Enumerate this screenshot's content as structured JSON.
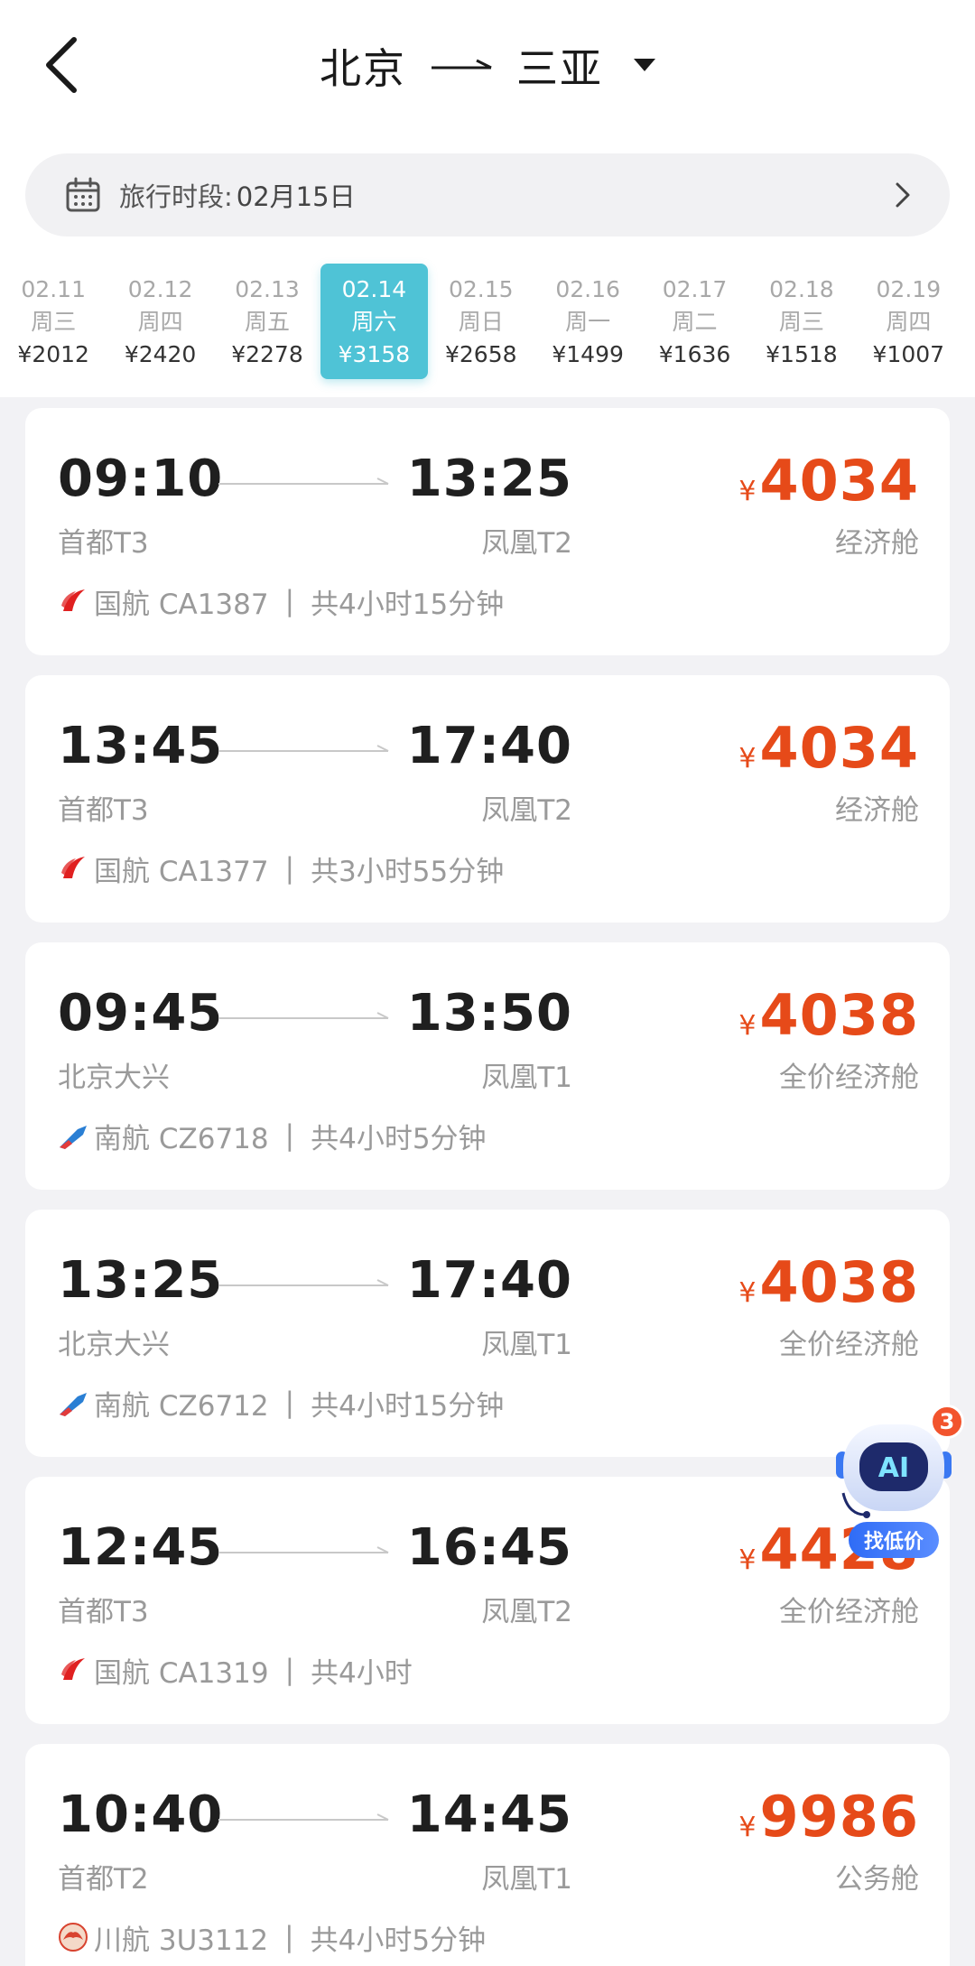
{
  "header": {
    "from": "北京",
    "to": "三亚"
  },
  "period": {
    "label": "旅行时段:",
    "value": "02月15日"
  },
  "dates": [
    {
      "date": "02.11",
      "weekday": "周三",
      "price": "¥2012",
      "active": false
    },
    {
      "date": "02.12",
      "weekday": "周四",
      "price": "¥2420",
      "active": false
    },
    {
      "date": "02.13",
      "weekday": "周五",
      "price": "¥2278",
      "active": false
    },
    {
      "date": "02.14",
      "weekday": "周六",
      "price": "¥3158",
      "active": true
    },
    {
      "date": "02.15",
      "weekday": "周日",
      "price": "¥2658",
      "active": false
    },
    {
      "date": "02.16",
      "weekday": "周一",
      "price": "¥1499",
      "active": false
    },
    {
      "date": "02.17",
      "weekday": "周二",
      "price": "¥1636",
      "active": false
    },
    {
      "date": "02.18",
      "weekday": "周三",
      "price": "¥1518",
      "active": false
    },
    {
      "date": "02.19",
      "weekday": "周四",
      "price": "¥1007",
      "active": false
    }
  ],
  "flights": [
    {
      "dep_time": "09:10",
      "arr_time": "13:25",
      "dep_airport": "首都T3",
      "arr_airport": "凤凰T2",
      "currency": "¥",
      "price": "4034",
      "cabin": "经济舱",
      "airline": "国航 CA1387",
      "separator": "|",
      "duration": "共4小时15分钟",
      "airline_icon": "air-china"
    },
    {
      "dep_time": "13:45",
      "arr_time": "17:40",
      "dep_airport": "首都T3",
      "arr_airport": "凤凰T2",
      "currency": "¥",
      "price": "4034",
      "cabin": "经济舱",
      "airline": "国航 CA1377",
      "separator": "|",
      "duration": "共3小时55分钟",
      "airline_icon": "air-china"
    },
    {
      "dep_time": "09:45",
      "arr_time": "13:50",
      "dep_airport": "北京大兴",
      "arr_airport": "凤凰T1",
      "currency": "¥",
      "price": "4038",
      "cabin": "全价经济舱",
      "airline": "南航 CZ6718",
      "separator": "|",
      "duration": "共4小时5分钟",
      "airline_icon": "china-southern"
    },
    {
      "dep_time": "13:25",
      "arr_time": "17:40",
      "dep_airport": "北京大兴",
      "arr_airport": "凤凰T1",
      "currency": "¥",
      "price": "4038",
      "cabin": "全价经济舱",
      "airline": "南航 CZ6712",
      "separator": "|",
      "duration": "共4小时15分钟",
      "airline_icon": "china-southern"
    },
    {
      "dep_time": "12:45",
      "arr_time": "16:45",
      "dep_airport": "首都T3",
      "arr_airport": "凤凰T2",
      "currency": "¥",
      "price": "4428",
      "cabin": "全价经济舱",
      "airline": "国航 CA1319",
      "separator": "|",
      "duration": "共4小时",
      "airline_icon": "air-china"
    },
    {
      "dep_time": "10:40",
      "arr_time": "14:45",
      "dep_airport": "首都T2",
      "arr_airport": "凤凰T1",
      "currency": "¥",
      "price": "9986",
      "cabin": "公务舱",
      "airline": "川航 3U3112",
      "separator": "|",
      "duration": "共4小时5分钟",
      "airline_icon": "sichuan-airlines"
    }
  ],
  "ai_assistant": {
    "badge": "3",
    "text": "AI",
    "label": "找低价"
  },
  "colors": {
    "accent": "#4fc3d6",
    "price": "#e64a19",
    "ai_blue": "#2f6cf6"
  }
}
